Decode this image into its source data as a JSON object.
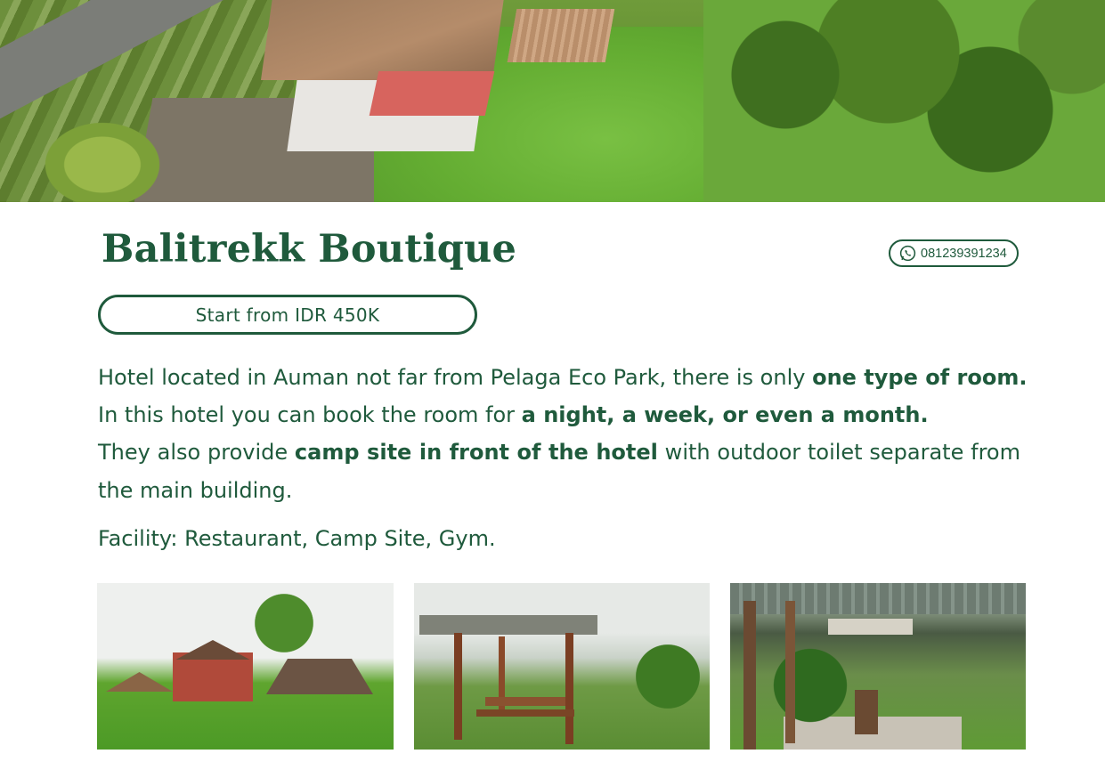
{
  "hero": {
    "image_alt": "Aerial view of the hotel grounds"
  },
  "header": {
    "title": "Balitrekk Boutique",
    "phone": "081239391234",
    "phone_icon": "whatsapp-icon"
  },
  "price": {
    "label": "Start from IDR 450K"
  },
  "description": {
    "line1_text": "Hotel located in Auman not far from Pelaga Eco Park, there is only ",
    "line1_bold": "one type of room.",
    "line2_text": "In this hotel you can book the room for ",
    "line2_bold": "a night, a week, or even a month.",
    "line3_text_a": "They also provide ",
    "line3_bold": "camp site in front of the hotel",
    "line3_text_b": " with outdoor toilet separate from the main building.",
    "facility": "Facility: Restaurant, Camp Site, Gym."
  },
  "colors": {
    "brand_green": "#1f5a3c",
    "background": "#ffffff"
  },
  "gallery": [
    {
      "alt": "Hotel building and lawn"
    },
    {
      "alt": "Wooden gazebo with picnic table"
    },
    {
      "alt": "Garden terrace restaurant"
    }
  ]
}
